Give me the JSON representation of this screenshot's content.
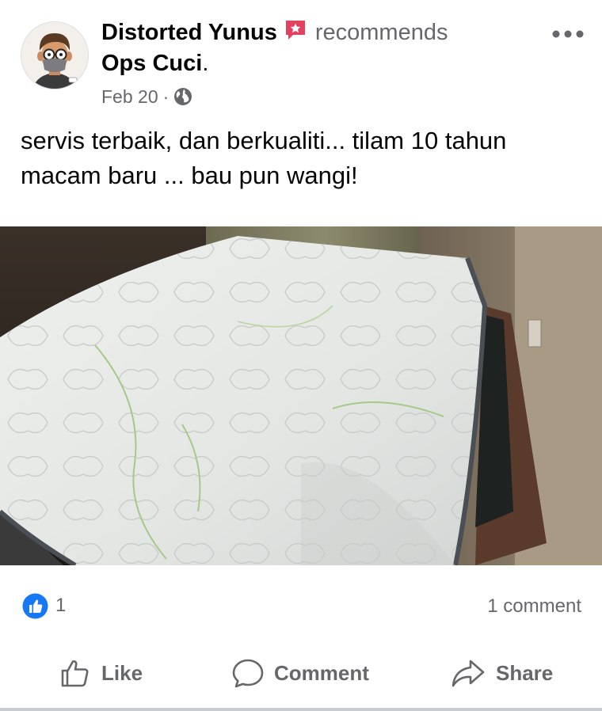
{
  "post": {
    "author": "Distorted Yunus",
    "action": "recommends",
    "page": "Ops Cuci",
    "page_suffix": ".",
    "date": "Feb 20",
    "date_separator": "·",
    "audience_icon": "globe-icon",
    "badge_icon": "recommendation-badge-icon",
    "text_line_1": "servis terbaik, dan berkualiti... tilam 10 tahun",
    "text_line_2": "macam baru ... bau pun wangi!",
    "photo_description_icon": "mattress-photo"
  },
  "reactions": {
    "like_count": "1",
    "comment_count": "1 comment"
  },
  "actions": {
    "like_label": "Like",
    "comment_label": "Comment",
    "share_label": "Share"
  },
  "colors": {
    "text_primary": "#050505",
    "text_secondary": "#65676b",
    "like_blue": "#1877f2",
    "badge_pink": "#e4405f"
  }
}
